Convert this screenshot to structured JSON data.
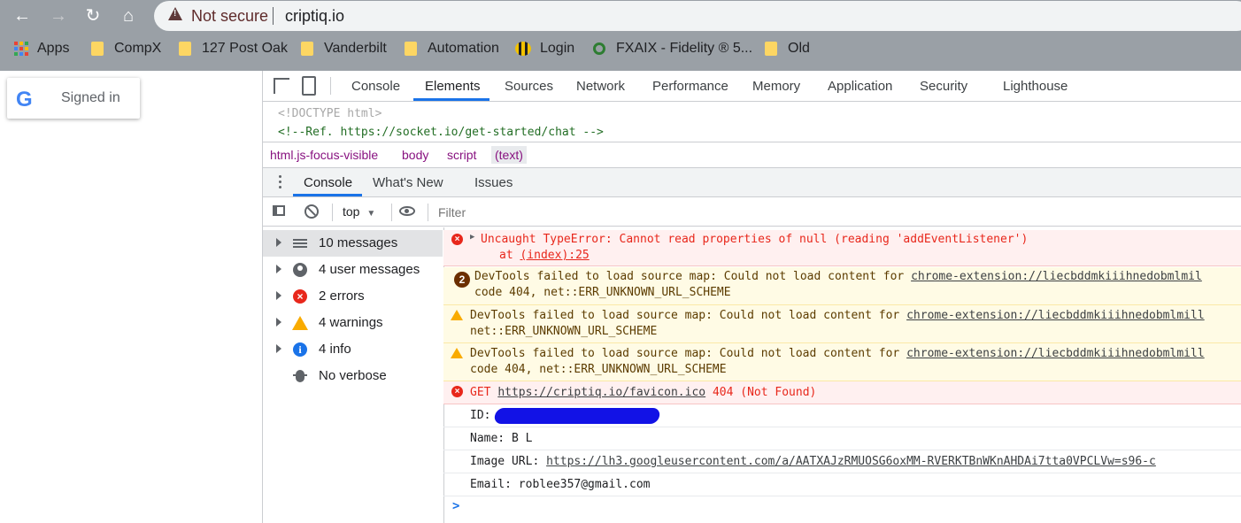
{
  "browser": {
    "security_label": "Not secure",
    "url": "criptiq.io",
    "bookmarks": [
      {
        "label": "Apps",
        "icon": "apps-grid-icon"
      },
      {
        "label": "CompX",
        "icon": "folder-icon"
      },
      {
        "label": "127 Post Oak",
        "icon": "folder-icon"
      },
      {
        "label": "Vanderbilt",
        "icon": "folder-icon"
      },
      {
        "label": "Automation",
        "icon": "folder-icon"
      },
      {
        "label": "Login",
        "icon": "bee-icon"
      },
      {
        "label": "FXAIX - Fidelity ® 5...",
        "icon": "fidelity-icon"
      },
      {
        "label": "Old",
        "icon": "folder-icon"
      }
    ]
  },
  "page": {
    "signed_in": "Signed in",
    "google_letter": "G"
  },
  "devtools": {
    "tabs": [
      "Console",
      "Elements",
      "Sources",
      "Network",
      "Performance",
      "Memory",
      "Application",
      "Security",
      "Lighthouse"
    ],
    "active_tab": "Elements",
    "dom_lines": [
      "<!DOCTYPE html>",
      "<!--Ref. https://socket.io/get-started/chat -->"
    ],
    "breadcrumbs": [
      "html.js-focus-visible",
      "body",
      "script",
      "(text)"
    ],
    "drawer_tabs": [
      "Console",
      "What's New",
      "Issues"
    ],
    "context": "top",
    "filter_placeholder": "Filter",
    "sidebar": [
      {
        "label": "10 messages",
        "icon": "list-icon"
      },
      {
        "label": "4 user messages",
        "icon": "user-icon"
      },
      {
        "label": "2 errors",
        "icon": "error-icon"
      },
      {
        "label": "4 warnings",
        "icon": "warning-icon"
      },
      {
        "label": "4 info",
        "icon": "info-icon"
      },
      {
        "label": "No verbose",
        "icon": "bug-icon"
      }
    ],
    "messages": {
      "m1_l1": "Uncaught TypeError: Cannot read properties of null (reading 'addEventListener')",
      "m1_l2_prefix": "at ",
      "m1_l2_link": "(index):25",
      "m2_count": "2",
      "m2_l1_text": "DevTools failed to load source map: Could not load content for ",
      "m2_l1_link": "chrome-extension://liecbddmkiiihnedobmlmil",
      "m2_l2": "code 404, net::ERR_UNKNOWN_URL_SCHEME",
      "m3_l1_text": "DevTools failed to load source map: Could not load content for ",
      "m3_l1_link": "chrome-extension://liecbddmkiiihnedobmlmill",
      "m3_l2": "net::ERR_UNKNOWN_URL_SCHEME",
      "m4_l1_text": "DevTools failed to load source map: Could not load content for ",
      "m4_l1_link": "chrome-extension://liecbddmkiiihnedobmlmill",
      "m4_l2": "code 404, net::ERR_UNKNOWN_URL_SCHEME",
      "m5_prefix": "GET ",
      "m5_link": "https://criptiq.io/favicon.ico",
      "m5_suffix": " 404 (Not Found)",
      "m6": "ID:",
      "m7": "Name: B L",
      "m8_prefix": "Image URL: ",
      "m8_link": "https://lh3.googleusercontent.com/a/AATXAJzRMUOSG6oxMM-RVERKTBnWKnAHDAi7tta0VPCLVw=s96-c",
      "m9": "Email: roblee357@gmail.com",
      "prompt": ">"
    }
  },
  "colors": {
    "accent": "#1a73e8",
    "error": "#e8271b",
    "warning": "#f9ab00",
    "chrome_bar": "#9aa0a6"
  }
}
